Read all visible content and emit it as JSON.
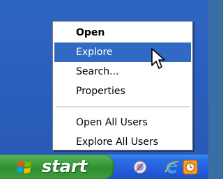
{
  "context_menu": {
    "items": [
      {
        "label": "Open",
        "bold": true,
        "highlighted": false
      },
      {
        "label": "Explore",
        "bold": false,
        "highlighted": true
      },
      {
        "label": "Search...",
        "bold": false,
        "highlighted": false
      },
      {
        "label": "Properties",
        "bold": false,
        "highlighted": false
      }
    ],
    "items_after_separator": [
      {
        "label": "Open All Users",
        "bold": false,
        "highlighted": false
      },
      {
        "label": "Explore All Users",
        "bold": false,
        "highlighted": false
      }
    ]
  },
  "taskbar": {
    "start_label": "start",
    "quick_launch": [
      {
        "icon": "desktop-cleanup-icon"
      },
      {
        "icon": "internet-explorer-icon"
      },
      {
        "icon": "media-player-icon"
      }
    ]
  },
  "colors": {
    "desktop": "#2b5fbd",
    "highlight": "#316ac5",
    "start_green": "#3c9e3e",
    "taskbar_blue": "#245edb"
  }
}
